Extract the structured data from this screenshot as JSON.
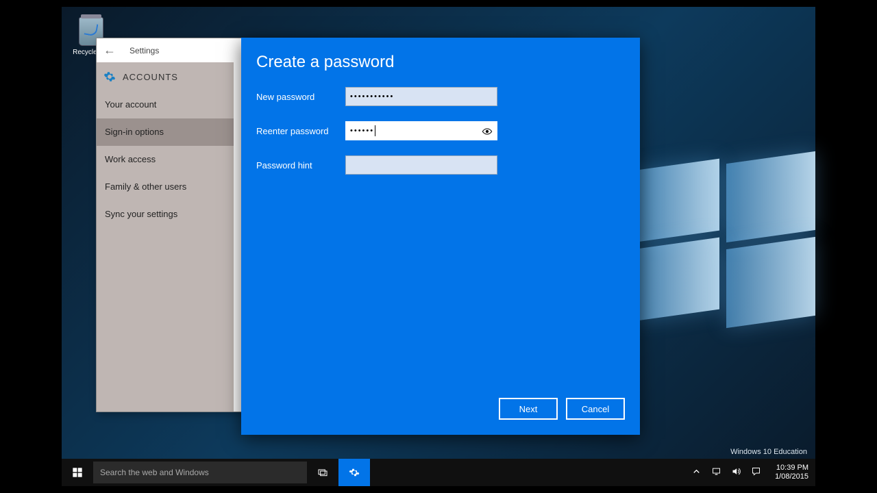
{
  "desktop": {
    "recycle_label": "Recycle Bin",
    "watermark": "Windows 10 Education"
  },
  "settings": {
    "back": "←",
    "title": "Settings",
    "header": "ACCOUNTS",
    "nav": [
      "Your account",
      "Sign-in options",
      "Work access",
      "Family & other users",
      "Sync your settings"
    ],
    "selected_index": 1
  },
  "dialog": {
    "title": "Create a password",
    "new_label": "New password",
    "new_value": "•••••••••••",
    "re_label": "Reenter password",
    "re_value": "••••••",
    "hint_label": "Password hint",
    "hint_value": "",
    "next": "Next",
    "cancel": "Cancel"
  },
  "taskbar": {
    "search_placeholder": "Search the web and Windows",
    "time": "10:39 PM",
    "date": "1/08/2015"
  }
}
